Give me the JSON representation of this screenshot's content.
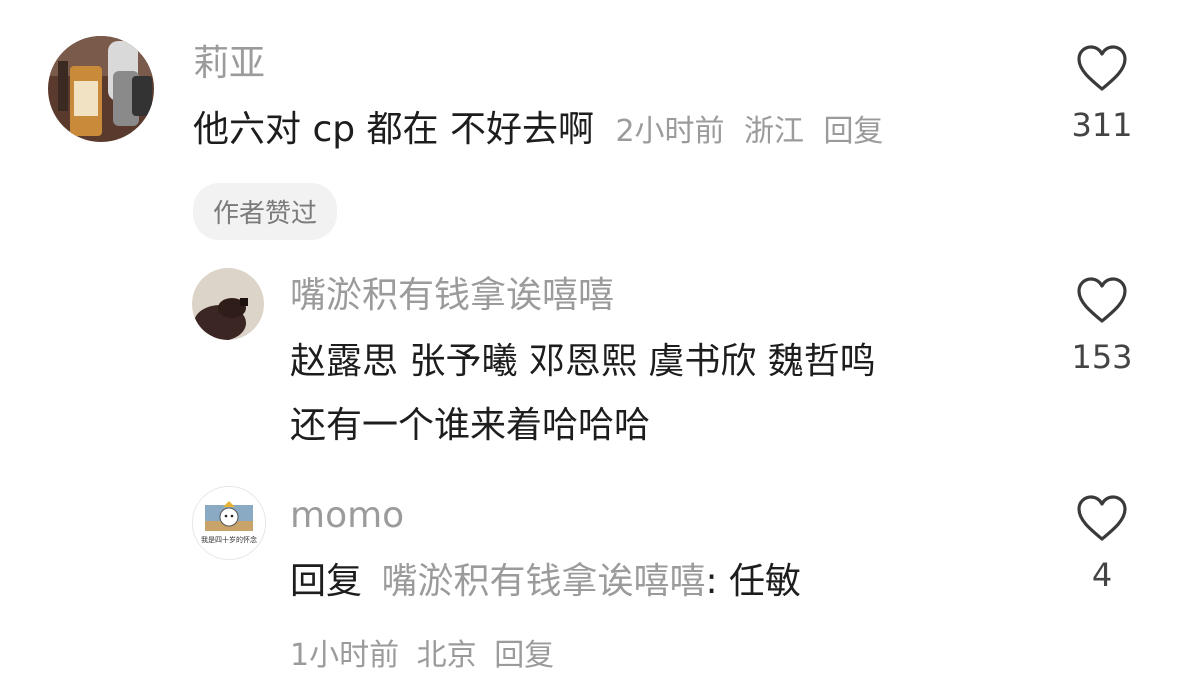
{
  "comments": [
    {
      "username": "莉亚",
      "text": "他六对 cp 都在 不好去啊",
      "time": "2小时前",
      "location": "浙江",
      "reply_label": "回复",
      "badge": "作者赞过",
      "likes": "311"
    },
    {
      "username": "嘴淤积有钱拿诶嘻嘻",
      "text_line1": "赵露思 张予曦 邓恩熙 虞书欣 魏哲鸣",
      "text_line2": "还有一个谁来着哈哈哈",
      "likes": "153"
    },
    {
      "username": "momo",
      "reply_prefix": "回复",
      "reply_target": "嘴淤积有钱拿诶嘻嘻",
      "reply_colon_text": ": 任敏",
      "time": "1小时前",
      "location": "北京",
      "reply_label": "回复",
      "likes": "4",
      "avatar_caption": "我是四十岁的怀念"
    }
  ],
  "colors": {
    "primary_text": "#1d1d1d",
    "secondary_text": "#9b9b9b",
    "badge_bg": "#f2f2f2",
    "icon_stroke": "#3a3a3a"
  },
  "icons": [
    "heart-icon"
  ]
}
